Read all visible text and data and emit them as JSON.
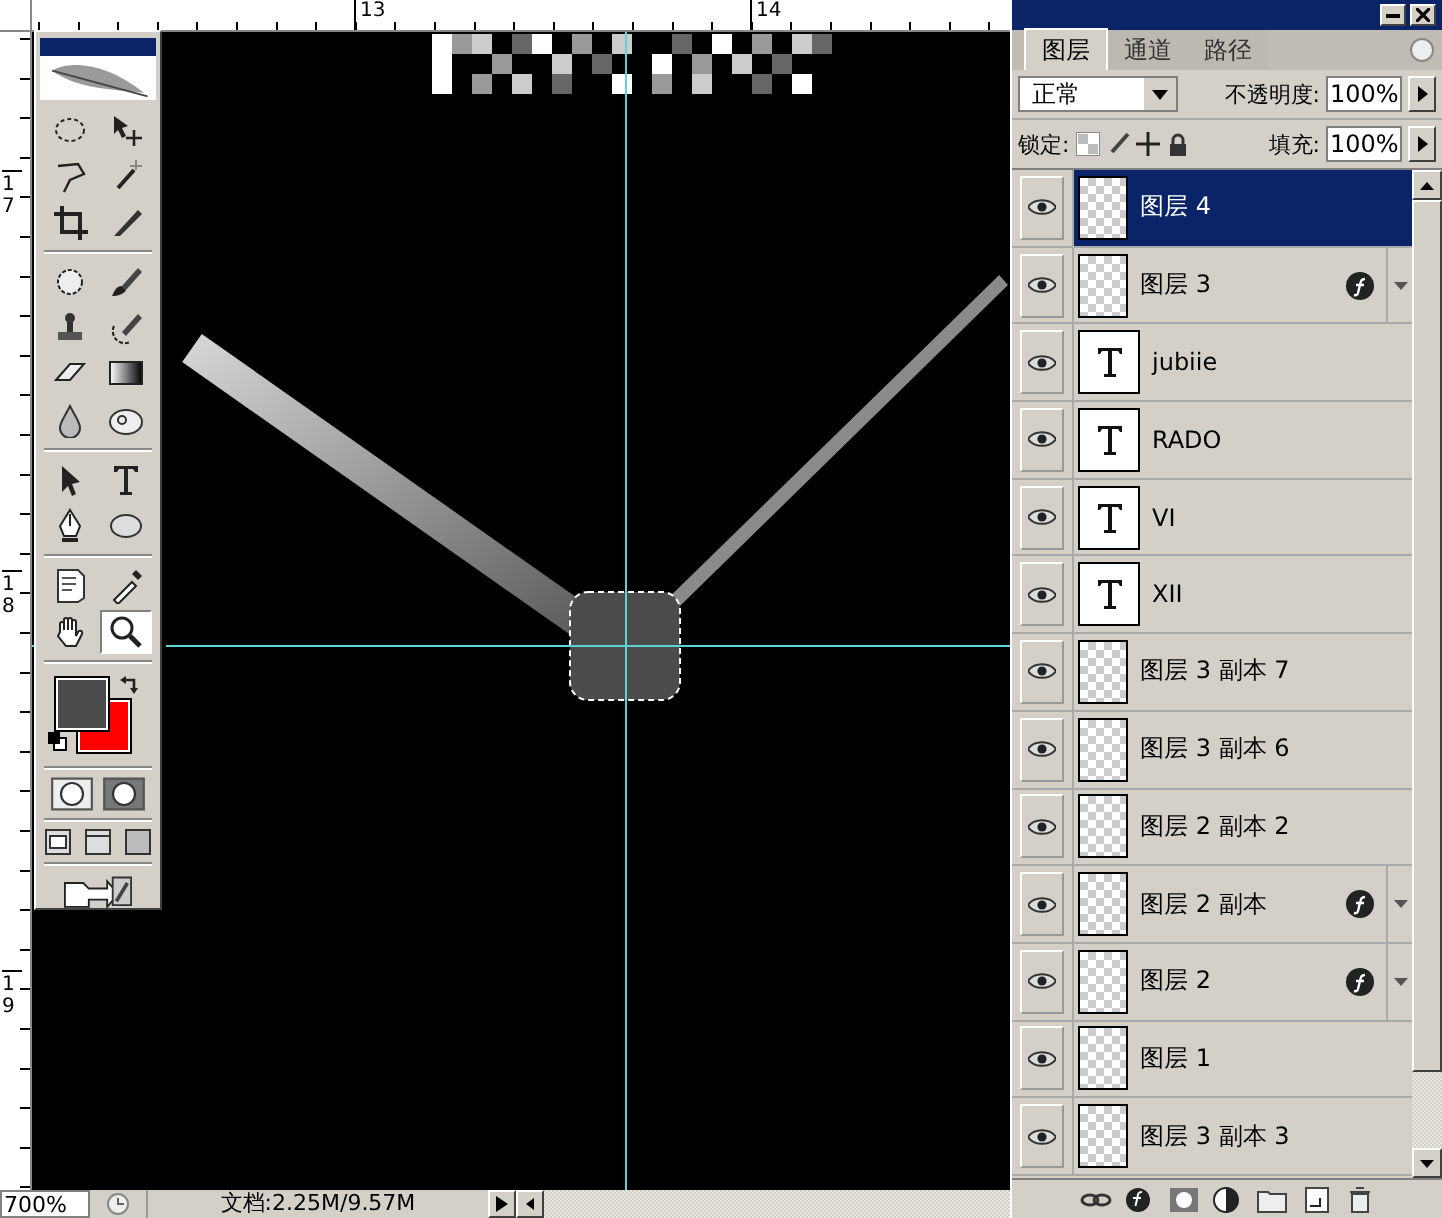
{
  "rulers": {
    "top_labels": [
      "13",
      "14"
    ],
    "left_labels": [
      "17",
      "18",
      "19"
    ]
  },
  "toolbox": {
    "tools": [
      {
        "selected": false
      },
      {
        "selected": false
      },
      {
        "selected": false
      },
      {
        "selected": false
      },
      {
        "selected": false
      },
      {
        "selected": false
      },
      {
        "selected": false
      },
      {
        "selected": false
      },
      {
        "selected": false
      },
      {
        "selected": false
      },
      {
        "selected": false
      },
      {
        "selected": false
      },
      {
        "selected": false
      },
      {
        "selected": false
      },
      {
        "selected": false
      },
      {
        "selected": false
      },
      {
        "selected": false
      },
      {
        "selected": false
      },
      {
        "selected": false
      },
      {
        "selected": false
      },
      {
        "selected": false
      },
      {
        "selected": true
      }
    ]
  },
  "layers_panel": {
    "tabs": [
      {
        "label": "图层",
        "selected": true
      },
      {
        "label": "通道",
        "selected": false
      },
      {
        "label": "路径",
        "selected": false
      }
    ],
    "blend_mode": "正常",
    "opacity_label": "不透明度:",
    "opacity": "100%",
    "lock_label": "锁定:",
    "fill_label": "填充:",
    "fill": "100%",
    "layers": [
      {
        "name": "图层 4",
        "kind": "pixel",
        "visible": true,
        "selected": true,
        "effects": false
      },
      {
        "name": "图层 3",
        "kind": "pixel",
        "visible": true,
        "selected": false,
        "effects": true
      },
      {
        "name": "jubiie",
        "kind": "text",
        "visible": true,
        "selected": false,
        "effects": false
      },
      {
        "name": "RADO",
        "kind": "text",
        "visible": true,
        "selected": false,
        "effects": false
      },
      {
        "name": "VI",
        "kind": "text",
        "visible": true,
        "selected": false,
        "effects": false
      },
      {
        "name": "XII",
        "kind": "text",
        "visible": true,
        "selected": false,
        "effects": false
      },
      {
        "name": "图层 3 副本 7",
        "kind": "pixel",
        "visible": true,
        "selected": false,
        "effects": false
      },
      {
        "name": "图层 3 副本 6",
        "kind": "pixel",
        "visible": true,
        "selected": false,
        "effects": false
      },
      {
        "name": "图层 2 副本 2",
        "kind": "pixel",
        "visible": true,
        "selected": false,
        "effects": false
      },
      {
        "name": "图层 2 副本",
        "kind": "pixel",
        "visible": true,
        "selected": false,
        "effects": true
      },
      {
        "name": "图层 2",
        "kind": "pixel",
        "visible": true,
        "selected": false,
        "effects": true
      },
      {
        "name": "图层 1",
        "kind": "pixel",
        "visible": true,
        "selected": false,
        "effects": false
      },
      {
        "name": "图层 3 副本 3",
        "kind": "pixel",
        "visible": true,
        "selected": false,
        "effects": false
      }
    ]
  },
  "status_bar": {
    "zoom": "700%",
    "doc_info": "文档:2.25M/9.57M"
  }
}
